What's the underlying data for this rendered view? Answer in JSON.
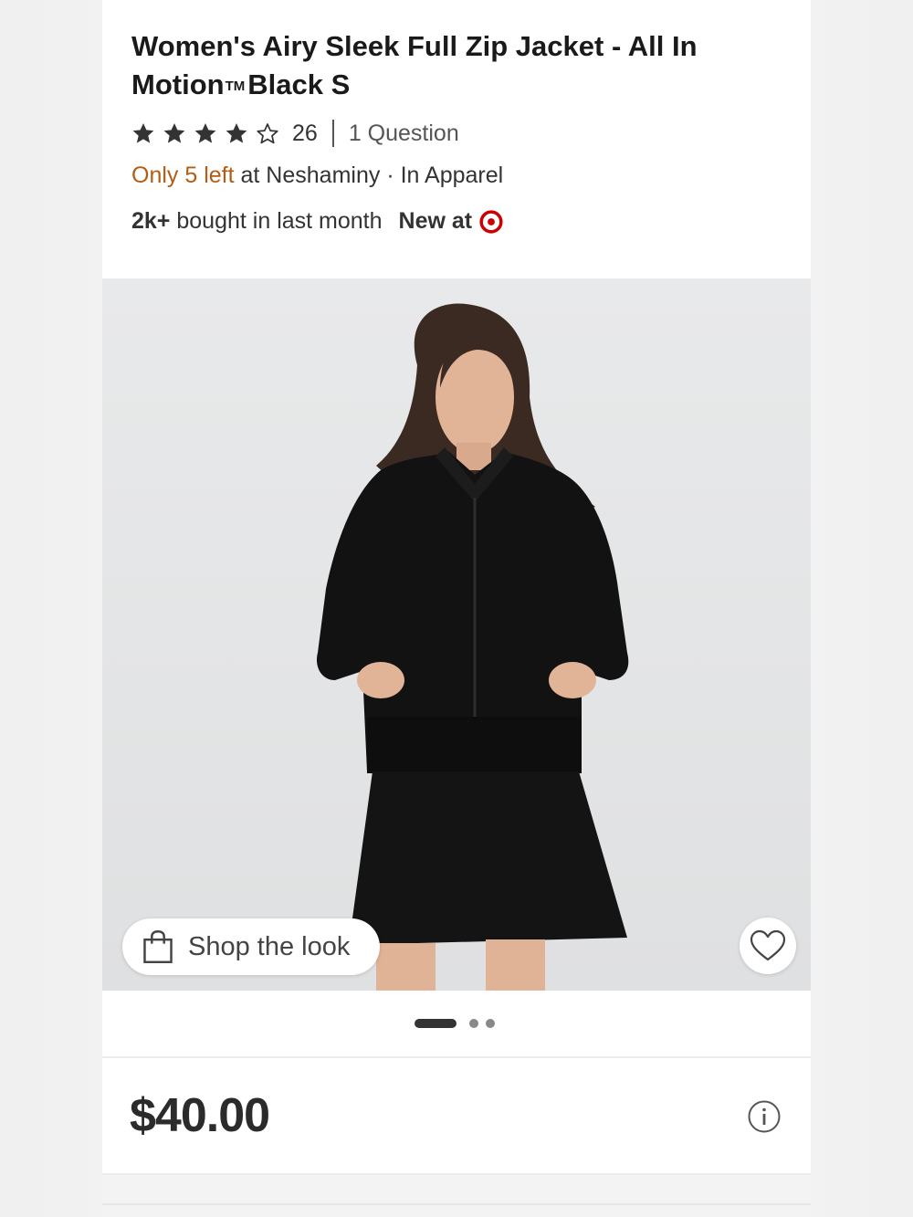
{
  "product": {
    "title_part1": "Women's Airy Sleek Full Zip Jacket - All In Motion",
    "trademark": "TM",
    "title_part2": "Black S",
    "rating": {
      "stars": 4,
      "max": 5,
      "count": "26"
    },
    "questions": "1 Question",
    "stock": {
      "alert": "Only 5 left",
      "store": "at Neshaminy",
      "location": "· In Apparel"
    },
    "bought": {
      "count": "2k+",
      "text": "bought in last month"
    },
    "new_at": "New at",
    "price": "$40.00"
  },
  "image": {
    "shop_the_look": "Shop the look",
    "carousel": {
      "total": 3,
      "active": 1
    }
  },
  "colors": {
    "stock_alert": "#b35c14",
    "target_red": "#cc0000",
    "garment": "#121212"
  }
}
